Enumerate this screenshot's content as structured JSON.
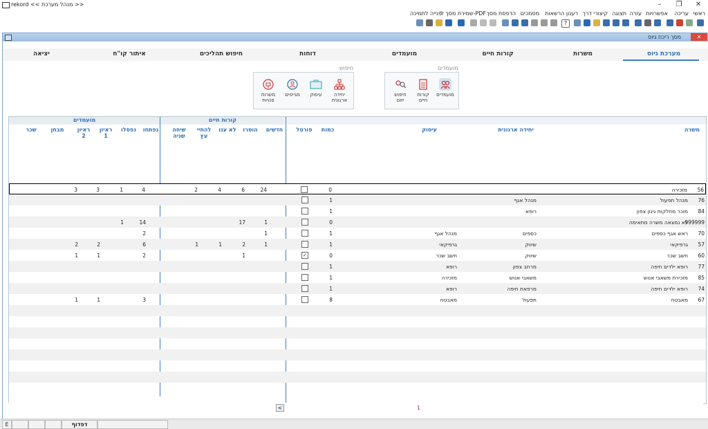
{
  "window": {
    "title": "rekord  << מנהל מערכת >>",
    "minimize": "–",
    "restore": "❐",
    "close": "✕"
  },
  "menu": [
    "ראשי",
    "עריכה",
    "אפשרויות",
    "עזרה",
    "תצוגה",
    "קיצורי דרך",
    "רענון הרשאות",
    "מסמכים",
    "הדפסת מסך",
    "שמירת מסך ל-PDF",
    "פנייה לתמיכה"
  ],
  "inner": {
    "title": "מסך ריכוז גיוס",
    "close": "✕"
  },
  "tabs": [
    "מערכת גיוס",
    "משרות",
    "קורות חיים",
    "מועמדים",
    "דוחות",
    "חיפוש תהליכים",
    "איתור קו\"ח",
    "יציאה"
  ],
  "groups": {
    "candidates_label": "מועמדים",
    "search_label": "חיפוש",
    "candidates": [
      {
        "label": "מועמדים",
        "icon": "candidates-icon"
      },
      {
        "label": "קורות\nחיים",
        "icon": "resume-icon"
      },
      {
        "label": "חיפוש\nיזום",
        "icon": "proactive-search-icon"
      }
    ],
    "search": [
      {
        "label": "יחידה\nארגונית",
        "icon": "org-unit-icon"
      },
      {
        "label": "עיסוק",
        "icon": "briefcase-icon"
      },
      {
        "label": "מגייסים",
        "icon": "recruiters-icon"
      },
      {
        "label": "משרות\nפנויות",
        "icon": "vacancies-icon"
      }
    ]
  },
  "grid": {
    "sections": {
      "candidates": "מועמדים",
      "resumes": "קורות חיים"
    },
    "headers": {
      "position": "משרה",
      "org_unit": "יחידה ארגונית",
      "occupation": "עיסוק",
      "quantity": "כמות",
      "portal": "פורטל",
      "new": "חדשים",
      "rejected": "הוסרו",
      "no_answer": "לא ענו",
      "to_start": "להתיי\nעץ",
      "second_call": "שיחה\nשניה",
      "started": "נפתחו",
      "failed": "נפסלו",
      "interview1": "ראיון\n1",
      "interview2": "ראיון\n2",
      "test": "מבחן",
      "salary": "שכר"
    },
    "rows": [
      {
        "id": "56",
        "position": "מזכירה",
        "unit": "",
        "occ": "",
        "qty": "0",
        "portal": false,
        "new": "24",
        "rej": "6",
        "noans": "4",
        "start": "2",
        "second": "",
        "opened": "4",
        "failed": "1",
        "i1": "3",
        "i2": "3",
        "test": "",
        "salary": ""
      },
      {
        "id": "76",
        "position": "מנהל תפעול",
        "unit": "מנהל אגף",
        "occ": "",
        "qty": "1",
        "portal": false,
        "new": "",
        "rej": "",
        "noans": "",
        "start": "",
        "second": "",
        "opened": "",
        "failed": "",
        "i1": "",
        "i2": "",
        "test": "",
        "salary": ""
      },
      {
        "id": "84",
        "position": "מוכר מחלקות גינון צפון",
        "unit": "רופא",
        "occ": "",
        "qty": "1",
        "portal": false,
        "new": "",
        "rej": "",
        "noans": "",
        "start": "",
        "second": "",
        "opened": "",
        "failed": "",
        "i1": "",
        "i2": "",
        "test": "",
        "salary": ""
      },
      {
        "id": "999999",
        "position": "לא נמצאה משרה מתאימה",
        "unit": "",
        "occ": "",
        "qty": "0",
        "portal": false,
        "new": "1",
        "rej": "17",
        "noans": "",
        "start": "",
        "second": "",
        "opened": "14",
        "failed": "1",
        "i1": "",
        "i2": "",
        "test": "",
        "salary": ""
      },
      {
        "id": "70",
        "position": "ראש אגף כספים",
        "unit": "כספים",
        "occ": "מנהל אגף",
        "qty": "1",
        "portal": false,
        "new": "1",
        "rej": "",
        "noans": "",
        "start": "",
        "second": "",
        "opened": "2",
        "failed": "",
        "i1": "",
        "i2": "",
        "test": "",
        "salary": ""
      },
      {
        "id": "57",
        "position": "גרפיקאי",
        "unit": "שיווק",
        "occ": "גרפיקאי",
        "qty": "1",
        "portal": false,
        "new": "1",
        "rej": "2",
        "noans": "1",
        "start": "1",
        "second": "",
        "opened": "6",
        "failed": "",
        "i1": "2",
        "i2": "2",
        "test": "",
        "salary": ""
      },
      {
        "id": "60",
        "position": "חשב שכר",
        "unit": "שיווק",
        "occ": "חשב שכר",
        "qty": "0",
        "portal": true,
        "new": "",
        "rej": "1",
        "noans": "",
        "start": "",
        "second": "",
        "opened": "2",
        "failed": "",
        "i1": "1",
        "i2": "1",
        "test": "",
        "salary": ""
      },
      {
        "id": "77",
        "position": "רופא ילדים חיפה",
        "unit": "מרחב צפון",
        "occ": "רופא",
        "qty": "1",
        "portal": false,
        "new": "",
        "rej": "",
        "noans": "",
        "start": "",
        "second": "",
        "opened": "",
        "failed": "",
        "i1": "",
        "i2": "",
        "test": "",
        "salary": ""
      },
      {
        "id": "85",
        "position": "מזכירת משאבי אנוש",
        "unit": "משאבי אנוש",
        "occ": "מזכירה",
        "qty": "1",
        "portal": false,
        "new": "",
        "rej": "",
        "noans": "",
        "start": "",
        "second": "",
        "opened": "",
        "failed": "",
        "i1": "",
        "i2": "",
        "test": "",
        "salary": ""
      },
      {
        "id": "74",
        "position": "רופא ילדים חיפה",
        "unit": "מרפאת חיפה",
        "occ": "רופא",
        "qty": "1",
        "portal": false,
        "new": "",
        "rej": "",
        "noans": "",
        "start": "",
        "second": "",
        "opened": "",
        "failed": "",
        "i1": "",
        "i2": "",
        "test": "",
        "salary": ""
      },
      {
        "id": "67",
        "position": "מאבטח",
        "unit": "תפעול",
        "occ": "מאבטח",
        "qty": "8",
        "portal": false,
        "new": "",
        "rej": "",
        "noans": "",
        "start": "",
        "second": "",
        "opened": "3",
        "failed": "",
        "i1": "1",
        "i2": "1",
        "test": "",
        "salary": ""
      }
    ]
  },
  "pager": {
    "prev": "<",
    "page": "1"
  },
  "status": {
    "lang": "E",
    "mode": "דפדוף"
  }
}
